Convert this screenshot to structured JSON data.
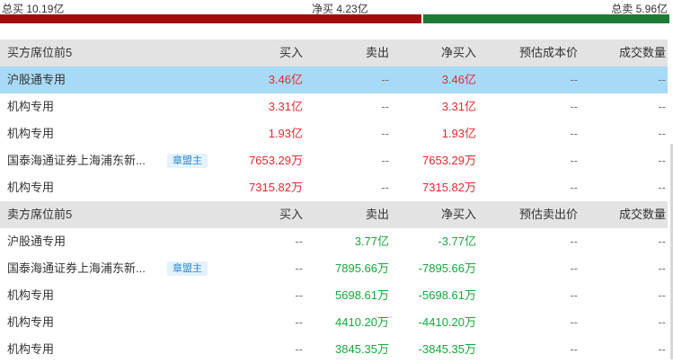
{
  "summary": {
    "total_buy": "总买 10.19亿",
    "net_buy": "净买 4.23亿",
    "total_sell": "总卖 5.96亿",
    "buy_ratio": 0.631,
    "colors": {
      "buy_bar": "#a30b0b",
      "sell_bar": "#1e7b35",
      "up": "#e8282e",
      "down": "#16a83a",
      "highlight": "#a7daf6"
    }
  },
  "buy_table": {
    "headers": [
      "买方席位前5",
      "买入",
      "卖出",
      "净买入",
      "预估成本价",
      "成交数量"
    ],
    "rows": [
      {
        "name": "沪股通专用",
        "tag": "",
        "buy": "3.46亿",
        "sell": "--",
        "net": "3.46亿",
        "price": "--",
        "volume": "--",
        "highlight": true
      },
      {
        "name": "机构专用",
        "tag": "",
        "buy": "3.31亿",
        "sell": "--",
        "net": "3.31亿",
        "price": "--",
        "volume": "--"
      },
      {
        "name": "机构专用",
        "tag": "",
        "buy": "1.93亿",
        "sell": "--",
        "net": "1.93亿",
        "price": "--",
        "volume": "--"
      },
      {
        "name": "国泰海通证券上海浦东新...",
        "tag": "章盟主",
        "buy": "7653.29万",
        "sell": "--",
        "net": "7653.29万",
        "price": "--",
        "volume": "--"
      },
      {
        "name": "机构专用",
        "tag": "",
        "buy": "7315.82万",
        "sell": "--",
        "net": "7315.82万",
        "price": "--",
        "volume": "--"
      }
    ]
  },
  "sell_table": {
    "headers": [
      "卖方席位前5",
      "买入",
      "卖出",
      "净买入",
      "预估卖出价",
      "成交数量"
    ],
    "rows": [
      {
        "name": "沪股通专用",
        "tag": "",
        "buy": "--",
        "sell": "3.77亿",
        "net": "-3.77亿",
        "price": "--",
        "volume": "--"
      },
      {
        "name": "国泰海通证券上海浦东新...",
        "tag": "章盟主",
        "buy": "--",
        "sell": "7895.66万",
        "net": "-7895.66万",
        "price": "--",
        "volume": "--"
      },
      {
        "name": "机构专用",
        "tag": "",
        "buy": "--",
        "sell": "5698.61万",
        "net": "-5698.61万",
        "price": "--",
        "volume": "--"
      },
      {
        "name": "机构专用",
        "tag": "",
        "buy": "--",
        "sell": "4410.20万",
        "net": "-4410.20万",
        "price": "--",
        "volume": "--"
      },
      {
        "name": "机构专用",
        "tag": "",
        "buy": "--",
        "sell": "3845.35万",
        "net": "-3845.35万",
        "price": "--",
        "volume": "--"
      }
    ]
  }
}
